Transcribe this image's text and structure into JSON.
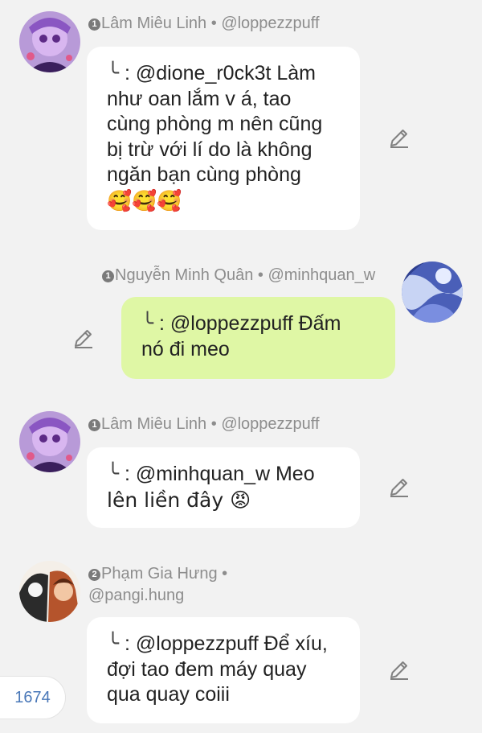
{
  "messages": [
    {
      "rank": "1",
      "name": "Lâm Miêu Linh",
      "sep": " • ",
      "handle": "@loppezzpuff",
      "reply_glyph": "╰",
      "lines": [
        ": @dione_r0ck3t Làm",
        "như oan lắm v á, tao",
        "cùng phòng m nên cũng",
        "bị trừ với lí do là không",
        "ngăn bạn cùng phòng"
      ],
      "emoji_line": "🥰🥰🥰"
    },
    {
      "rank": "1",
      "name": "Nguyễn Minh Quân",
      "sep": " • ",
      "handle": "@minhquan_w",
      "reply_glyph": "╰",
      "lines": [
        ": @loppezzpuff Đấm",
        "nó đi meo"
      ]
    },
    {
      "rank": "1",
      "name": "Lâm Miêu Linh",
      "sep": " • ",
      "handle": "@loppezzpuff",
      "reply_glyph": "╰",
      "lines": [
        ": @minhquan_w Meo",
        "lên liền đây 😡"
      ]
    },
    {
      "rank": "2",
      "name": "Phạm Gia Hưng",
      "sep": " •",
      "handle": "@pangi.hung",
      "reply_glyph": "╰",
      "lines": [
        ": @loppezzpuff Để xíu,",
        "đợi tao đem máy quay",
        "qua quay coiii"
      ]
    }
  ],
  "reply_count": "1674",
  "icons": {
    "edit": "pencil-icon",
    "rank": "rank-badge-icon"
  },
  "colors": {
    "own_bubble": "#dff7a5",
    "other_bubble": "#ffffff",
    "background": "#f2f2f2",
    "count_text": "#4a78b8"
  }
}
